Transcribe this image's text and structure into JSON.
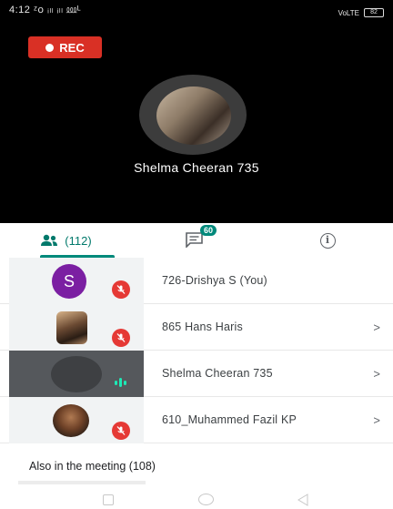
{
  "status_bar": {
    "time": "4:12",
    "signal_text": "ᶻ꧐ ᵢₗₗ ᵢₗₗ ⅏ᴸ",
    "network_icon": "volte-icon",
    "battery_label": "82"
  },
  "video": {
    "rec_label": "REC",
    "speaker_name": "Shelma Cheeran 735"
  },
  "tabs": {
    "people_label": "(112)",
    "chat_badge": "60",
    "info_glyph": "i"
  },
  "participants": [
    {
      "name": "726-Drishya S (You)",
      "avatar_letter": "S",
      "muted": true,
      "chevron": ""
    },
    {
      "name": "865 Hans Haris",
      "avatar_letter": "",
      "muted": true,
      "chevron": ">"
    },
    {
      "name": "Shelma Cheeran 735",
      "avatar_letter": "",
      "muted": false,
      "chevron": ">"
    },
    {
      "name": "610_Muhammed Fazil KP",
      "avatar_letter": "",
      "muted": true,
      "chevron": ">"
    }
  ],
  "also_label": "Also in the meeting (108)",
  "colors": {
    "accent": "#00897b",
    "rec": "#d93025",
    "mute": "#e53935",
    "avatar_s": "#7b1fa2"
  }
}
